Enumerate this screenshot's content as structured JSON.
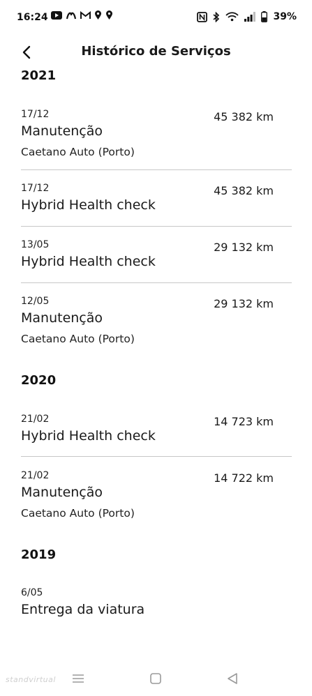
{
  "status_bar": {
    "time": "16:24",
    "battery": "39%",
    "icons_left": [
      "youtube-icon",
      "vinted-icon",
      "gmail-icon",
      "location-icon",
      "location-icon"
    ],
    "icons_right": [
      "nfc-icon",
      "bluetooth-icon",
      "wifi-icon",
      "signal-icon",
      "battery-icon"
    ]
  },
  "header": {
    "title": "Histórico de Serviços",
    "back_icon": "chevron-left-icon"
  },
  "years": [
    {
      "year": "2021",
      "entries": [
        {
          "date": "17/12",
          "title": "Manutenção",
          "place": "Caetano Auto (Porto)",
          "km": "45 382 km"
        },
        {
          "date": "17/12",
          "title": "Hybrid Health check",
          "place": "",
          "km": "45 382 km"
        },
        {
          "date": "13/05",
          "title": "Hybrid Health check",
          "place": "",
          "km": "29 132 km"
        },
        {
          "date": "12/05",
          "title": "Manutenção",
          "place": "Caetano Auto (Porto)",
          "km": "29 132 km"
        }
      ]
    },
    {
      "year": "2020",
      "entries": [
        {
          "date": "21/02",
          "title": "Hybrid Health check",
          "place": "",
          "km": "14 723 km"
        },
        {
          "date": "21/02",
          "title": "Manutenção",
          "place": "Caetano Auto (Porto)",
          "km": "14 722 km"
        }
      ]
    },
    {
      "year": "2019",
      "entries": [
        {
          "date": "6/05",
          "title": "Entrega da viatura",
          "place": "",
          "km": ""
        }
      ]
    }
  ],
  "nav_bar": {
    "icons": [
      "recents-icon",
      "home-icon",
      "back-icon"
    ]
  },
  "watermark": "standvirtual"
}
